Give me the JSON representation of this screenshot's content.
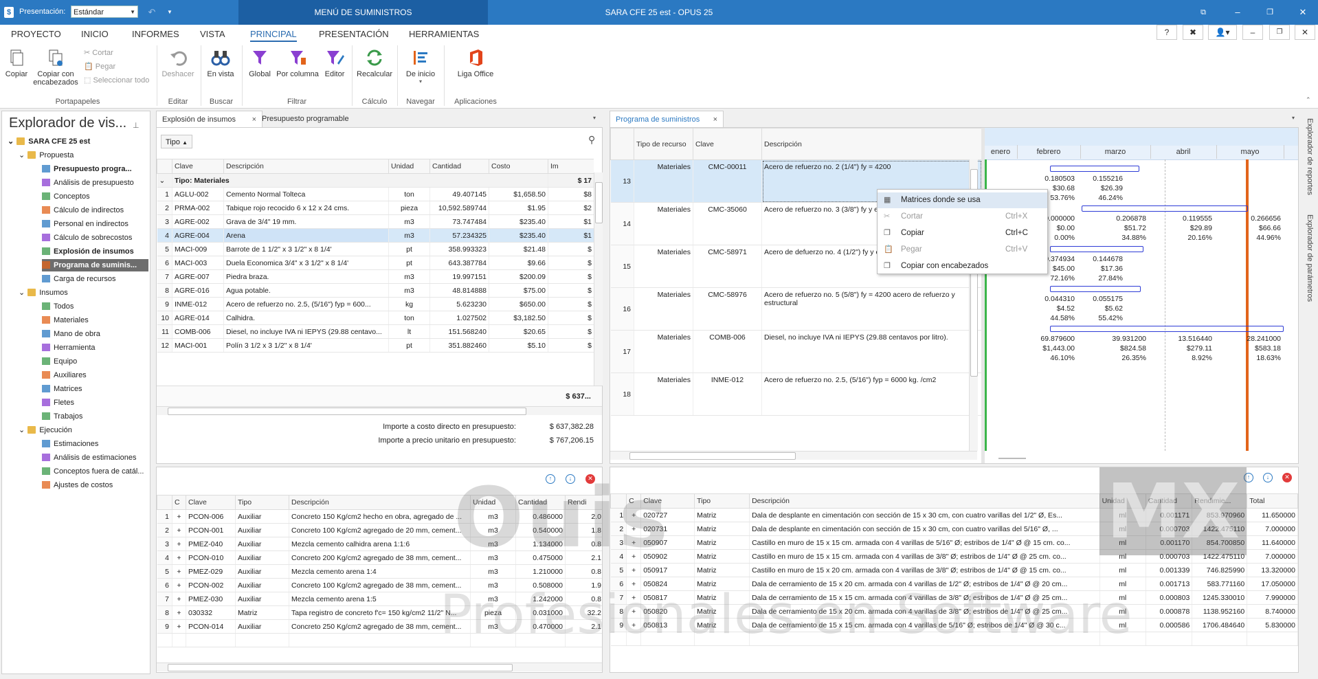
{
  "titlebar": {
    "presentation_label": "Presentación:",
    "presentation_value": "Estándar",
    "menu_suministros": "MENÚ DE SUMINISTROS",
    "app_title": "SARA CFE 25 est - OPUS 25"
  },
  "menubar": {
    "tabs": [
      "PROYECTO",
      "INICIO",
      "INFORMES",
      "VISTA",
      "PRINCIPAL",
      "PRESENTACIÓN",
      "HERRAMIENTAS"
    ],
    "active_tab": "PRINCIPAL",
    "help": "?"
  },
  "ribbon": {
    "copiar": "Copiar",
    "copiar_enc": "Copiar con encabezados",
    "cortar": "Cortar",
    "pegar": "Pegar",
    "seleccionar_todo": "Seleccionar todo",
    "deshacer": "Deshacer",
    "en_vista": "En vista",
    "global": "Global",
    "por_columna": "Por columna",
    "editor": "Editor",
    "recalcular": "Recalcular",
    "de_inicio": "De inicio",
    "liga_office": "Liga Office",
    "groups": {
      "portapapeles": "Portapapeles",
      "editar": "Editar",
      "buscar": "Buscar",
      "filtrar": "Filtrar",
      "calculo": "Cálculo",
      "navegar": "Navegar",
      "aplicaciones": "Aplicaciones"
    }
  },
  "explorer": {
    "title": "Explorador de vis...",
    "root": "SARA CFE 25 est",
    "items": [
      {
        "label": "Propuesta",
        "level": 1,
        "kind": "folder"
      },
      {
        "label": "Presupuesto progra...",
        "level": 2,
        "kind": "doc",
        "bold": true
      },
      {
        "label": "Análisis de presupuesto",
        "level": 2,
        "kind": "doc"
      },
      {
        "label": "Conceptos",
        "level": 2,
        "kind": "doc"
      },
      {
        "label": "Cálculo de indirectos",
        "level": 2,
        "kind": "doc"
      },
      {
        "label": "Personal en indirectos",
        "level": 2,
        "kind": "doc"
      },
      {
        "label": "Cálculo de sobrecostos",
        "level": 2,
        "kind": "doc"
      },
      {
        "label": "Explosión de insumos",
        "level": 2,
        "kind": "doc",
        "bold": true
      },
      {
        "label": "Programa de suminis...",
        "level": 2,
        "kind": "doc",
        "bold": true,
        "selected": true
      },
      {
        "label": "Carga de recursos",
        "level": 2,
        "kind": "doc"
      },
      {
        "label": "Insumos",
        "level": 1,
        "kind": "folder"
      },
      {
        "label": "Todos",
        "level": 2,
        "kind": "doc"
      },
      {
        "label": "Materiales",
        "level": 2,
        "kind": "doc"
      },
      {
        "label": "Mano de obra",
        "level": 2,
        "kind": "doc"
      },
      {
        "label": "Herramienta",
        "level": 2,
        "kind": "doc"
      },
      {
        "label": "Equipo",
        "level": 2,
        "kind": "doc"
      },
      {
        "label": "Auxiliares",
        "level": 2,
        "kind": "doc"
      },
      {
        "label": "Matrices",
        "level": 2,
        "kind": "doc"
      },
      {
        "label": "Fletes",
        "level": 2,
        "kind": "doc"
      },
      {
        "label": "Trabajos",
        "level": 2,
        "kind": "doc"
      },
      {
        "label": "Ejecución",
        "level": 1,
        "kind": "folder"
      },
      {
        "label": "Estimaciones",
        "level": 2,
        "kind": "doc"
      },
      {
        "label": "Análisis de estimaciones",
        "level": 2,
        "kind": "doc"
      },
      {
        "label": "Conceptos fuera de catál...",
        "level": 2,
        "kind": "doc"
      },
      {
        "label": "Ajustes de costos",
        "level": 2,
        "kind": "doc"
      }
    ]
  },
  "explosion": {
    "tabs": [
      "Explosión de insumos",
      "Presupuesto programable"
    ],
    "tipo_chip": "Tipo",
    "columns": [
      "Clave",
      "Descripción",
      "Unidad",
      "Cantidad",
      "Costo",
      "Im"
    ],
    "group_label": "Tipo: Materiales",
    "group_total": "$ 17",
    "rows": [
      {
        "n": "1",
        "clave": "AGLU-002",
        "desc": "Cemento Normal Tolteca",
        "unidad": "ton",
        "cantidad": "49.407145",
        "costo": "$1,658.50",
        "im": "$8"
      },
      {
        "n": "2",
        "clave": "PRMA-002",
        "desc": "Tabique rojo recocido 6 x 12 x 24 cms.",
        "unidad": "pieza",
        "cantidad": "10,592.589744",
        "costo": "$1.95",
        "im": "$2"
      },
      {
        "n": "3",
        "clave": "AGRE-002",
        "desc": "Grava de 3/4\" 19 mm.",
        "unidad": "m3",
        "cantidad": "73.747484",
        "costo": "$235.40",
        "im": "$1"
      },
      {
        "n": "4",
        "clave": "AGRE-004",
        "desc": "Arena",
        "unidad": "m3",
        "cantidad": "57.234325",
        "costo": "$235.40",
        "im": "$1"
      },
      {
        "n": "5",
        "clave": "MACI-009",
        "desc": "Barrote de 1 1/2\" x 3 1/2\" x 8 1/4'",
        "unidad": "pt",
        "cantidad": "358.993323",
        "costo": "$21.48",
        "im": "$"
      },
      {
        "n": "6",
        "clave": "MACI-003",
        "desc": "Duela Economica 3/4\" x 3 1/2\" x 8 1/4'",
        "unidad": "pt",
        "cantidad": "643.387784",
        "costo": "$9.66",
        "im": "$"
      },
      {
        "n": "7",
        "clave": "AGRE-007",
        "desc": "Piedra braza.",
        "unidad": "m3",
        "cantidad": "19.997151",
        "costo": "$200.09",
        "im": "$"
      },
      {
        "n": "8",
        "clave": "AGRE-016",
        "desc": "Agua potable.",
        "unidad": "m3",
        "cantidad": "48.814888",
        "costo": "$75.00",
        "im": "$"
      },
      {
        "n": "9",
        "clave": "INME-012",
        "desc": "Acero de refuerzo no. 2.5, (5/16\") fyp = 600...",
        "unidad": "kg",
        "cantidad": "5.623230",
        "costo": "$650.00",
        "im": "$"
      },
      {
        "n": "10",
        "clave": "AGRE-014",
        "desc": "Calhidra.",
        "unidad": "ton",
        "cantidad": "1.027502",
        "costo": "$3,182.50",
        "im": "$"
      },
      {
        "n": "11",
        "clave": "COMB-006",
        "desc": "Diesel, no incluye IVA ni IEPYS (29.88 centavo...",
        "unidad": "lt",
        "cantidad": "151.568240",
        "costo": "$20.65",
        "im": "$"
      },
      {
        "n": "12",
        "clave": "MACI-001",
        "desc": "Polín 3 1/2 x 3 1/2\" x 8 1/4'",
        "unidad": "pt",
        "cantidad": "351.882460",
        "costo": "$5.10",
        "im": "$"
      }
    ],
    "footer_total": "$ 637...",
    "importe_costo_label": "Importe a costo directo en presupuesto:",
    "importe_costo_value": "$ 637,382.28",
    "importe_precio_label": "Importe a precio unitario en presupuesto:",
    "importe_precio_value": "$ 767,206.15"
  },
  "bottom_left": {
    "columns": [
      "C",
      "Clave",
      "Tipo",
      "Descripción",
      "Unidad",
      "Cantidad",
      "Rendi"
    ],
    "rows": [
      {
        "n": "1",
        "clave": "PCON-006",
        "tipo": "Auxiliar",
        "desc": "Concreto 150 Kg/cm2 hecho en obra, agregado de ...",
        "unidad": "m3",
        "cantidad": "0.486000",
        "rend": "2.0"
      },
      {
        "n": "2",
        "clave": "PCON-001",
        "tipo": "Auxiliar",
        "desc": "Concreto 100 Kg/cm2 agregado de 20 mm, cement...",
        "unidad": "m3",
        "cantidad": "0.540000",
        "rend": "1.8"
      },
      {
        "n": "3",
        "clave": "PMEZ-040",
        "tipo": "Auxiliar",
        "desc": "Mezcla cemento calhidra arena 1:1:6",
        "unidad": "m3",
        "cantidad": "1.134000",
        "rend": "0.8"
      },
      {
        "n": "4",
        "clave": "PCON-010",
        "tipo": "Auxiliar",
        "desc": "Concreto 200 Kg/cm2 agregado de 38 mm, cement...",
        "unidad": "m3",
        "cantidad": "0.475000",
        "rend": "2.1"
      },
      {
        "n": "5",
        "clave": "PMEZ-029",
        "tipo": "Auxiliar",
        "desc": "Mezcla cemento arena 1:4",
        "unidad": "m3",
        "cantidad": "1.210000",
        "rend": "0.8"
      },
      {
        "n": "6",
        "clave": "PCON-002",
        "tipo": "Auxiliar",
        "desc": "Concreto 100 Kg/cm2 agregado de 38 mm, cement...",
        "unidad": "m3",
        "cantidad": "0.508000",
        "rend": "1.9"
      },
      {
        "n": "7",
        "clave": "PMEZ-030",
        "tipo": "Auxiliar",
        "desc": "Mezcla cemento arena 1:5",
        "unidad": "m3",
        "cantidad": "1.242000",
        "rend": "0.8"
      },
      {
        "n": "8",
        "clave": "030332",
        "tipo": "Matriz",
        "desc": "Tapa registro de concreto f'c= 150 kg/cm2 11/2\" N...",
        "unidad": "pieza",
        "cantidad": "0.031000",
        "rend": "32.2"
      },
      {
        "n": "9",
        "clave": "PCON-014",
        "tipo": "Auxiliar",
        "desc": "Concreto 250 Kg/cm2 agregado de 38 mm, cement...",
        "unidad": "m3",
        "cantidad": "0.470000",
        "rend": "2.1"
      }
    ]
  },
  "programa": {
    "tab": "Programa de suministros",
    "columns": [
      "Tipo de recurso",
      "Clave",
      "Descripción"
    ],
    "rows": [
      {
        "n": "13",
        "tipo": "Materiales",
        "clave": "CMC-00011",
        "desc": "Acero de refuerzo no. 2 (1/4\") fy = 4200"
      },
      {
        "n": "14",
        "tipo": "Materiales",
        "clave": "CMC-35060",
        "desc": "Acero de refuerzo no. 3 (3/8\") fy y estructural"
      },
      {
        "n": "15",
        "tipo": "Materiales",
        "clave": "CMC-58971",
        "desc": "Acero de defuerzo no. 4 (1/2\") fy y estructural"
      },
      {
        "n": "16",
        "tipo": "Materiales",
        "clave": "CMC-58976",
        "desc": "Acero de refuerzo no. 5 (5/8\") fy = 4200 acero de refuerzo y estructural"
      },
      {
        "n": "17",
        "tipo": "Materiales",
        "clave": "COMB-006",
        "desc": "Diesel, no incluye IVA ni IEPYS (29.88 centavos por litro)."
      },
      {
        "n": "18",
        "tipo": "Materiales",
        "clave": "INME-012",
        "desc": "Acero de refuerzo no. 2.5, (5/16\") fyp = 6000 kg. /cm2"
      }
    ],
    "months": [
      "enero",
      "febrero",
      "marzo",
      "abril",
      "mayo"
    ],
    "gantt_values": [
      [
        "0.180503",
        "0.155216",
        "$30.68",
        "$26.39",
        "53.76%",
        "46.24%"
      ],
      [
        "0.000000",
        "0.206878",
        "0.119555",
        "0.266656",
        "$0.00",
        "$51.72",
        "$29.89",
        "$66.66",
        "0.00%",
        "34.88%",
        "20.16%",
        "44.96%"
      ],
      [
        "0.374934",
        "0.144678",
        "$45.00",
        "$17.36",
        "72.16%",
        "27.84%"
      ],
      [
        "0.044310",
        "0.055175",
        "$4.52",
        "$5.62",
        "44.58%",
        "55.42%"
      ],
      [
        "69.879600",
        "39.931200",
        "13.516440",
        "28.241000",
        "$1,443.00",
        "$824.58",
        "$279.11",
        "$583.18",
        "46.10%",
        "26.35%",
        "8.92%",
        "18.63%"
      ]
    ]
  },
  "context_menu": {
    "items": [
      {
        "label": "Matrices donde se usa",
        "shortcut": "",
        "disabled": false
      },
      {
        "label": "Cortar",
        "shortcut": "Ctrl+X",
        "disabled": true
      },
      {
        "label": "Copiar",
        "shortcut": "Ctrl+C",
        "disabled": false
      },
      {
        "label": "Pegar",
        "shortcut": "Ctrl+V",
        "disabled": true
      },
      {
        "label": "Copiar con encabezados",
        "shortcut": "",
        "disabled": false
      }
    ]
  },
  "bottom_right": {
    "columns": [
      "C",
      "Clave",
      "Tipo",
      "Descripción",
      "Unidad",
      "Cantidad",
      "Rendimie...",
      "Total"
    ],
    "rows": [
      {
        "n": "1",
        "clave": "020727",
        "tipo": "Matriz",
        "desc": "Dala de desplante en cimentación con sección de 15 x 30 cm, con cuatro varillas del 1/2\" Ø, Es...",
        "unidad": "ml",
        "cantidad": "0.001171",
        "rend": "853.970960",
        "total": "11.650000"
      },
      {
        "n": "2",
        "clave": "020731",
        "tipo": "Matriz",
        "desc": "Dala de desplante en cimentación con sección de 15 x 30 cm, con cuatro varillas del 5/16\" Ø, ...",
        "unidad": "ml",
        "cantidad": "0.000703",
        "rend": "1422.475110",
        "total": "7.000000"
      },
      {
        "n": "3",
        "clave": "050907",
        "tipo": "Matriz",
        "desc": "Castillo en muro de 15 x 15 cm. armada con 4 varillas de 5/16\" Ø; estribos de 1/4\" Ø @ 15 cm. co...",
        "unidad": "ml",
        "cantidad": "0.001170",
        "rend": "854.700850",
        "total": "11.640000"
      },
      {
        "n": "4",
        "clave": "050902",
        "tipo": "Matriz",
        "desc": "Castillo en muro de 15 x 15 cm. armada con 4 varillas de 3/8\" Ø; estribos de 1/4\" Ø @ 25 cm. co...",
        "unidad": "ml",
        "cantidad": "0.000703",
        "rend": "1422.475110",
        "total": "7.000000"
      },
      {
        "n": "5",
        "clave": "050917",
        "tipo": "Matriz",
        "desc": "Castillo en muro de 15 x 20 cm. armada con 4 varillas de 3/8\" Ø; estribos de 1/4\" Ø @ 15 cm. co...",
        "unidad": "ml",
        "cantidad": "0.001339",
        "rend": "746.825990",
        "total": "13.320000"
      },
      {
        "n": "6",
        "clave": "050824",
        "tipo": "Matriz",
        "desc": "Dala de cerramiento de 15 x 20 cm. armada con 4 varillas de 1/2\" Ø; estribos de 1/4\" Ø @ 20 cm...",
        "unidad": "ml",
        "cantidad": "0.001713",
        "rend": "583.771160",
        "total": "17.050000"
      },
      {
        "n": "7",
        "clave": "050817",
        "tipo": "Matriz",
        "desc": "Dala de cerramiento de 15 x 15 cm. armada con 4 varillas de 3/8\" Ø; estribos de 1/4\" Ø @ 25 cm...",
        "unidad": "ml",
        "cantidad": "0.000803",
        "rend": "1245.330010",
        "total": "7.990000"
      },
      {
        "n": "8",
        "clave": "050820",
        "tipo": "Matriz",
        "desc": "Dala de cerramiento de 15 x 20 cm. armada con 4 varillas de 3/8\" Ø; estribos de 1/4\" Ø @ 25 cm...",
        "unidad": "ml",
        "cantidad": "0.000878",
        "rend": "1138.952160",
        "total": "8.740000"
      },
      {
        "n": "9",
        "clave": "050813",
        "tipo": "Matriz",
        "desc": "Dala de cerramiento de 15 x 15 cm. armada con 4 varillas de 5/16\" Ø; estribos de 1/4\" Ø @ 30 c...",
        "unidad": "ml",
        "cantidad": "0.000586",
        "rend": "1706.484640",
        "total": "5.830000"
      }
    ]
  },
  "side_tabs": [
    "Explorador de reportes",
    "Explorador de parámetros"
  ],
  "watermark": {
    "line1": "Ouis",
    "line1b": "MX",
    "line2": "Profesionales en Software"
  },
  "colors": {
    "accent": "#2b79c2",
    "titlebar": "#2b79c2",
    "gantt_bar": "#2d3bd6",
    "today_line": "#e2641b",
    "start_line": "#3bb54a"
  }
}
